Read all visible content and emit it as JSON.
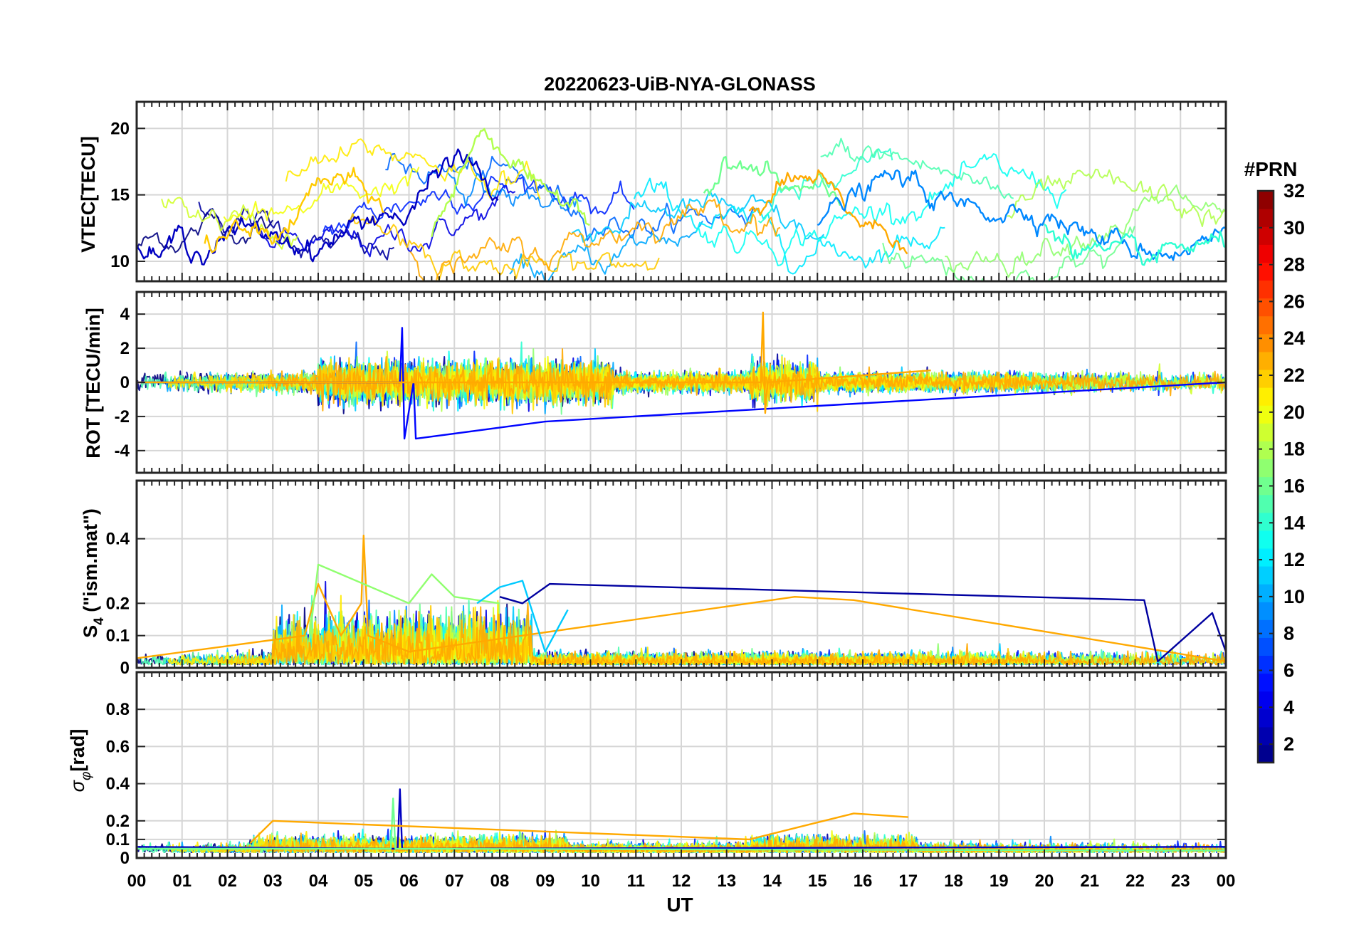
{
  "figure": {
    "title": "20220623-UiB-NYA-GLONASS",
    "x_axis_label": "UT"
  },
  "chart_data": [
    {
      "type": "line",
      "panel": "VTEC",
      "ylabel": "VTEC[TECU]",
      "ylim": [
        8.5,
        22
      ],
      "yticks": [
        10,
        15,
        20
      ],
      "xlim": [
        0,
        24
      ],
      "grid": true,
      "series": [
        {
          "prn": 3,
          "x": [
            0,
            0.5,
            1,
            1.5,
            2,
            3,
            4,
            4.5,
            5,
            5.5,
            6,
            6.5,
            7,
            7.5,
            8
          ],
          "values": [
            11,
            10,
            12,
            11,
            12,
            12,
            11,
            12,
            13,
            14,
            13,
            16,
            18,
            17,
            14
          ]
        },
        {
          "prn": 22,
          "x": [
            1.5,
            2,
            3,
            3.5,
            4,
            4.5,
            5,
            5.5
          ],
          "values": [
            11,
            12,
            12,
            13,
            16,
            16,
            15,
            14
          ]
        },
        {
          "prn": 18,
          "x": [
            6.5,
            7,
            7.5,
            8,
            8.5,
            9,
            9.5,
            10
          ],
          "values": [
            12,
            15,
            20,
            19,
            17,
            14,
            15,
            14
          ]
        },
        {
          "prn": 16,
          "x": [
            12.5,
            13,
            13.5,
            14,
            14.5,
            15,
            15.5
          ],
          "values": [
            15,
            17,
            17,
            16,
            15,
            15,
            14
          ]
        },
        {
          "prn": 23,
          "x": [
            13.5,
            14,
            14.5,
            15,
            15.5,
            16,
            16.5,
            17
          ],
          "values": [
            14,
            15,
            16,
            16,
            14,
            13,
            12,
            12
          ]
        },
        {
          "prn": 9,
          "x": [
            15,
            16,
            16.5,
            17,
            17.5,
            18,
            19,
            20,
            21,
            22,
            23,
            24
          ],
          "values": [
            13,
            15,
            16,
            16,
            15,
            14,
            14,
            14,
            12,
            11,
            11,
            12
          ]
        },
        {
          "prn": 14,
          "x": [
            20,
            21,
            21.5,
            22,
            22.5,
            23,
            24
          ],
          "values": [
            13,
            11,
            10,
            10,
            10,
            11,
            11
          ]
        }
      ]
    },
    {
      "type": "line",
      "panel": "ROT",
      "ylabel": "ROT [TECU/min]",
      "ylim": [
        -5.3,
        5.3
      ],
      "yticks": [
        -4,
        -2,
        0,
        2,
        4
      ],
      "xlim": [
        0,
        24
      ],
      "grid": true,
      "series": [
        {
          "prn": 5,
          "x": [
            0,
            5.8,
            5.85,
            5.9,
            6.1,
            6.15,
            9,
            24
          ],
          "values": [
            0,
            0,
            3.2,
            -3.3,
            0,
            -3.3,
            -2.3,
            0
          ]
        },
        {
          "prn": 23,
          "x": [
            0,
            13.75,
            13.8,
            13.85,
            13.9,
            17.5
          ],
          "values": [
            0,
            0,
            4.1,
            -1.8,
            0,
            0.7
          ]
        }
      ]
    },
    {
      "type": "line",
      "panel": "S4",
      "ylabel": "S4 (\"ism.mat\")",
      "ylim": [
        0,
        0.58
      ],
      "yticks": [
        0,
        0.1,
        0.2,
        0.4
      ],
      "xlim": [
        0,
        24
      ],
      "grid": true,
      "series": [
        {
          "prn": 23,
          "x": [
            0,
            3.7,
            4,
            4.5,
            4.95,
            5,
            5.1,
            6,
            14.5,
            15.8,
            24
          ],
          "values": [
            0.03,
            0.1,
            0.26,
            0.1,
            0.2,
            0.41,
            0.1,
            0.05,
            0.22,
            0.21,
            0.02
          ]
        },
        {
          "prn": 17,
          "x": [
            3.8,
            4,
            6,
            6.5,
            7,
            8
          ],
          "values": [
            0.08,
            0.32,
            0.2,
            0.29,
            0.22,
            0.2
          ]
        },
        {
          "prn": 11,
          "x": [
            7.5,
            8,
            8.5,
            9,
            9.5
          ],
          "values": [
            0.2,
            0.25,
            0.27,
            0.05,
            0.18
          ]
        },
        {
          "prn": 2,
          "x": [
            8,
            8.5,
            9.1,
            22.2,
            22.5,
            23.7,
            24
          ],
          "values": [
            0.22,
            0.2,
            0.26,
            0.21,
            0.02,
            0.17,
            0.05
          ]
        }
      ]
    },
    {
      "type": "line",
      "panel": "sigma_phi",
      "ylabel": "σφ[rad]",
      "ylim": [
        0,
        1
      ],
      "yticks": [
        0,
        0.1,
        0.2,
        0.4,
        0.6,
        0.8
      ],
      "xlim": [
        0,
        24
      ],
      "grid": true,
      "series": [
        {
          "prn": 3,
          "x": [
            0,
            5.75,
            5.8,
            5.85,
            24
          ],
          "values": [
            0.06,
            0.05,
            0.37,
            0.05,
            0.06
          ]
        },
        {
          "prn": 16,
          "x": [
            0,
            5.6,
            5.65,
            5.7,
            24
          ],
          "values": [
            0.05,
            0.05,
            0.32,
            0.05,
            0.04
          ]
        },
        {
          "prn": 23,
          "x": [
            2.5,
            3,
            5,
            13.5,
            15.8,
            17
          ],
          "values": [
            0.08,
            0.2,
            0.18,
            0.1,
            0.24,
            0.22
          ]
        }
      ]
    }
  ],
  "x_ticks": [
    "00",
    "01",
    "02",
    "03",
    "04",
    "05",
    "06",
    "07",
    "08",
    "09",
    "10",
    "11",
    "12",
    "13",
    "14",
    "15",
    "16",
    "17",
    "18",
    "19",
    "20",
    "21",
    "22",
    "23",
    "00"
  ],
  "colorbar": {
    "title": "#PRN",
    "min": 1,
    "max": 32,
    "ticks": [
      2,
      4,
      6,
      8,
      10,
      12,
      14,
      16,
      18,
      20,
      22,
      24,
      26,
      28,
      30,
      32
    ],
    "colormap": "jet"
  },
  "panel_labels": {
    "vtec": "VTEC[TECU]",
    "rot": "ROT [TECU/min]",
    "s4_main": "S",
    "s4_sub": "4",
    "s4_rest": " (\"ism.mat\")",
    "sig_main": "σ",
    "sig_sub": "φ",
    "sig_rest": "[rad]"
  }
}
